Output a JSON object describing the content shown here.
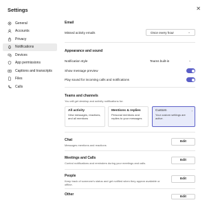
{
  "window": {
    "title": "Settings",
    "close_glyph": "✕"
  },
  "sidebar": {
    "items": [
      {
        "label": "General",
        "icon": "gear-icon"
      },
      {
        "label": "Accounts",
        "icon": "person-icon"
      },
      {
        "label": "Privacy",
        "icon": "lock-icon"
      },
      {
        "label": "Notifications",
        "icon": "bell-icon",
        "active": true
      },
      {
        "label": "Devices",
        "icon": "devices-icon"
      },
      {
        "label": "App permissions",
        "icon": "shield-icon"
      },
      {
        "label": "Captions and transcripts",
        "icon": "captions-icon"
      },
      {
        "label": "Files",
        "icon": "file-icon"
      },
      {
        "label": "Calls",
        "icon": "phone-icon"
      }
    ]
  },
  "email": {
    "heading": "Email",
    "missed_label": "Missed activity emails",
    "missed_value": "Once every hour"
  },
  "appearance": {
    "heading": "Appearance and sound",
    "style_label": "Notification style",
    "style_value": "Teams built-in",
    "preview_label": "Show message preview",
    "preview_on": true,
    "sound_label": "Play sound for incoming calls and notifications",
    "sound_on": true
  },
  "teams_channels": {
    "heading": "Teams and channels",
    "desc": "You will get desktop and activity notifications for:",
    "cards": [
      {
        "title": "All activity",
        "desc": "View messages, reactions, and all mentions",
        "selected": false
      },
      {
        "title": "Mentions & replies",
        "desc": "Personal mentions and replies to your messages",
        "selected": false
      },
      {
        "title": "Custom",
        "desc": "Your custom settings are active.",
        "selected": true
      }
    ]
  },
  "chat": {
    "heading": "Chat",
    "desc": "Messages mentions and reactions",
    "button": "Edit"
  },
  "meetings": {
    "heading": "Meetings and Calls",
    "desc": "Control notifications and reminders during your meetings and calls.",
    "button": "Edit"
  },
  "people": {
    "heading": "People",
    "desc": "Keep track of someone's status and get notified when they appear available or offline.",
    "button": "Edit"
  },
  "other": {
    "heading": "Other",
    "button": "Edit"
  },
  "colors": {
    "accent": "#5b5fc7",
    "selected_card_bg": "#e8ebfa",
    "active_nav_bg": "#ebebeb"
  }
}
